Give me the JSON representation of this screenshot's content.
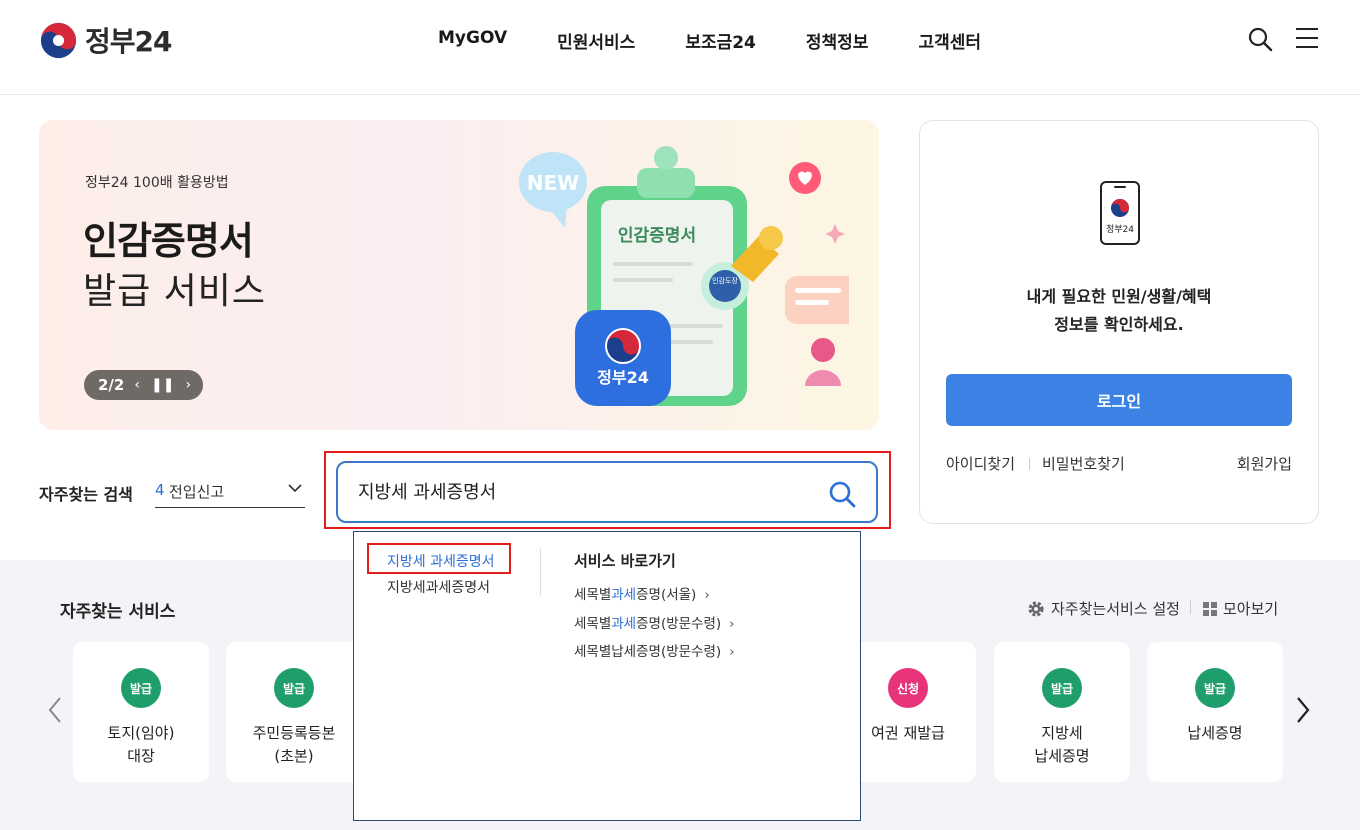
{
  "header": {
    "logo_text": "정부24",
    "nav": [
      "MyGOV",
      "민원서비스",
      "보조금24",
      "정책정보",
      "고객센터"
    ]
  },
  "banner": {
    "kicker": "정부24 100배 활용방법",
    "title_bold": "인감증명서",
    "title_regular": "발급 서비스",
    "pager": "2/2",
    "art_new": "NEW",
    "art_doc_title": "인감증명서",
    "art_stamp": "인감도장",
    "art_app_label": "정부24"
  },
  "login": {
    "app_label": "정부24",
    "message_line1": "내게 필요한 민원/생활/혜택",
    "message_line2": "정보를 확인하세요.",
    "login_button": "로그인",
    "find_id": "아이디찾기",
    "find_password": "비밀번호찾기",
    "signup": "회원가입"
  },
  "search": {
    "label": "자주찾는 검색",
    "select_number": "4",
    "select_value": "전입신고",
    "query": "지방세 과세증명서"
  },
  "dropdown": {
    "suggestions": [
      "지방세 과세증명서",
      "지방세과세증명서"
    ],
    "shortcut_heading": "서비스 바로가기",
    "shortcuts": [
      {
        "before": "세목별",
        "highlight": "과세",
        "after": "증명(서울)"
      },
      {
        "before": "세목별",
        "highlight": "과세",
        "after": "증명(방문수령)"
      },
      {
        "before": "세목별납세증명(방문수령)",
        "highlight": "",
        "after": ""
      }
    ],
    "arrow": "›"
  },
  "favorites": {
    "title": "자주찾는 서비스",
    "setting_label": "자주찾는서비스 설정",
    "view_all_label": "모아보기",
    "cards": [
      {
        "badge": "발급",
        "color": "#1f9d6b",
        "line1": "토지(임야)",
        "line2": "대장"
      },
      {
        "badge": "발급",
        "color": "#1f9d6b",
        "line1": "주민등록등본",
        "line2": "(초본)"
      },
      {
        "badge": "신청",
        "color": "#e8347a",
        "line1": "여권 재발급",
        "line2": ""
      },
      {
        "badge": "발급",
        "color": "#1f9d6b",
        "line1": "지방세",
        "line2": "납세증명"
      },
      {
        "badge": "발급",
        "color": "#1f9d6b",
        "line1": "납세증명",
        "line2": ""
      }
    ]
  }
}
